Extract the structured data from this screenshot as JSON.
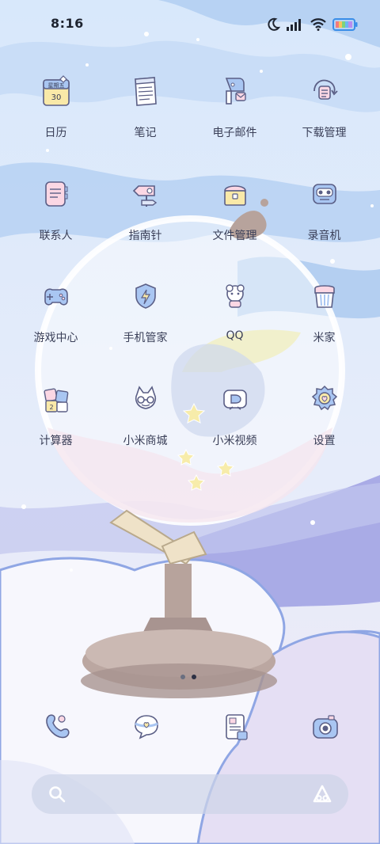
{
  "status_bar": {
    "time": "8:16"
  },
  "apps": [
    {
      "label": "日历",
      "icon": "calendar-icon",
      "icon_text_top": "星期五",
      "icon_text_bottom": "30"
    },
    {
      "label": "笔记",
      "icon": "notes-icon"
    },
    {
      "label": "电子邮件",
      "icon": "email-icon"
    },
    {
      "label": "下载管理",
      "icon": "download-manager-icon"
    },
    {
      "label": "联系人",
      "icon": "contacts-icon"
    },
    {
      "label": "指南针",
      "icon": "compass-icon"
    },
    {
      "label": "文件管理",
      "icon": "file-manager-icon"
    },
    {
      "label": "录音机",
      "icon": "recorder-icon"
    },
    {
      "label": "游戏中心",
      "icon": "game-center-icon"
    },
    {
      "label": "手机管家",
      "icon": "security-icon"
    },
    {
      "label": "QQ",
      "icon": "qq-icon"
    },
    {
      "label": "米家",
      "icon": "mijia-icon"
    },
    {
      "label": "计算器",
      "icon": "calculator-icon"
    },
    {
      "label": "小米商城",
      "icon": "mi-store-icon"
    },
    {
      "label": "小米视频",
      "icon": "mi-video-icon"
    },
    {
      "label": "设置",
      "icon": "settings-icon"
    }
  ],
  "dock": [
    {
      "icon": "phone-icon"
    },
    {
      "icon": "messages-icon"
    },
    {
      "icon": "browser-icon"
    },
    {
      "icon": "camera-icon"
    }
  ],
  "pager": {
    "pages": 2,
    "current": 2
  },
  "colors": {
    "outline": "#5b5f86",
    "label": "#3a3f58",
    "sky": "#cfe2f8",
    "wave": "#a9c9f0",
    "ground": "#e7e2f3"
  }
}
